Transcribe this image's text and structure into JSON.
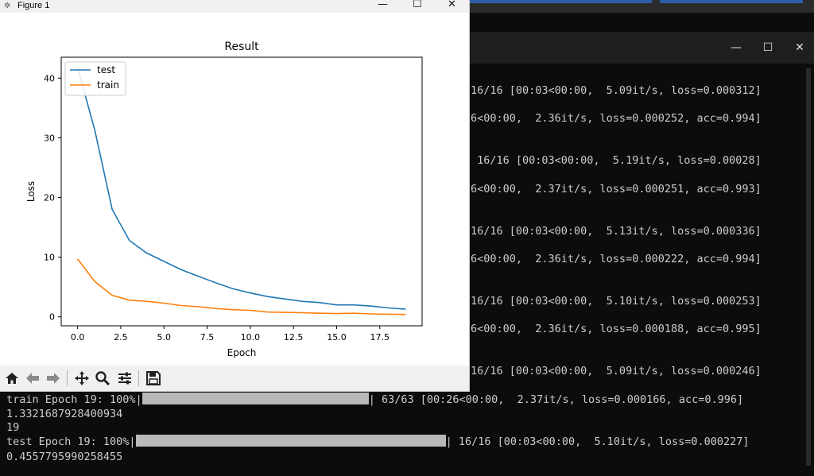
{
  "figure_window": {
    "title": "Figure 1",
    "controls": {
      "minimize": "—",
      "maximize": "☐",
      "close": "✕"
    }
  },
  "terminal_window": {
    "controls": {
      "minimize": "—",
      "maximize": "☐",
      "close": "✕"
    }
  },
  "toolbar": {
    "buttons": [
      "home-icon",
      "back-icon",
      "forward-icon",
      "pan-icon",
      "zoom-icon",
      "configure-subplots-icon",
      "save-icon"
    ]
  },
  "chart_data": {
    "type": "line",
    "title": "Result",
    "xlabel": "Epoch",
    "ylabel": "Loss",
    "xlim": [
      -0.95,
      19.95
    ],
    "ylim": [
      -1.5,
      43.5
    ],
    "xticks": [
      0.0,
      2.5,
      5.0,
      7.5,
      10.0,
      12.5,
      15.0,
      17.5
    ],
    "xtick_labels": [
      "0.0",
      "2.5",
      "5.0",
      "7.5",
      "10.0",
      "12.5",
      "15.0",
      "17.5"
    ],
    "yticks": [
      0,
      10,
      20,
      30,
      40
    ],
    "ytick_labels": [
      "0",
      "10",
      "20",
      "30",
      "40"
    ],
    "legend_position": "upper-left",
    "x": [
      0,
      1,
      2,
      3,
      4,
      5,
      6,
      7,
      8,
      9,
      10,
      11,
      12,
      13,
      14,
      15,
      16,
      17,
      18,
      19
    ],
    "series": [
      {
        "name": "test",
        "color": "#1f77b4",
        "values": [
          41.8,
          31.2,
          18.0,
          12.8,
          10.7,
          9.3,
          7.9,
          6.8,
          5.7,
          4.7,
          4.0,
          3.4,
          3.0,
          2.6,
          2.4,
          2.0,
          2.0,
          1.8,
          1.5,
          1.3
        ]
      },
      {
        "name": "train",
        "color": "#ff7f0e",
        "values": [
          9.7,
          5.9,
          3.6,
          2.8,
          2.6,
          2.3,
          1.9,
          1.7,
          1.4,
          1.2,
          1.1,
          0.8,
          0.75,
          0.7,
          0.6,
          0.55,
          0.6,
          0.5,
          0.45,
          0.4
        ]
      }
    ]
  },
  "terminal": {
    "lines": [
      {
        "text": "16/16 [00:03<00:00,  5.09it/s, loss=0.000312]"
      },
      {
        "text": "6<00:00,  2.36it/s, loss=0.000252, acc=0.994]"
      },
      {
        "text": " 16/16 [00:03<00:00,  5.19it/s, loss=0.00028]"
      },
      {
        "text": "6<00:00,  2.37it/s, loss=0.000251, acc=0.993]"
      },
      {
        "text": "16/16 [00:03<00:00,  5.13it/s, loss=0.000336]"
      },
      {
        "text": "6<00:00,  2.36it/s, loss=0.000222, acc=0.994]"
      },
      {
        "text": "16/16 [00:03<00:00,  5.10it/s, loss=0.000253]"
      },
      {
        "text": "6<00:00,  2.36it/s, loss=0.000188, acc=0.995]"
      },
      {
        "text": "16/16 [00:03<00:00,  5.09it/s, loss=0.000246]"
      }
    ],
    "train_epoch": {
      "prefix": "train Epoch 19: 100%|",
      "progress": 1.0,
      "suffix": "| 63/63 [00:26<00:00,  2.37it/s, loss=0.000166, acc=0.996]"
    },
    "value_1": "1.3321687928400934",
    "value_2": "19",
    "test_epoch": {
      "prefix": "test Epoch 19: 100%|",
      "progress": 1.0,
      "suffix": "| 16/16 [00:03<00:00,  5.10it/s, loss=0.000227]"
    },
    "value_3": "0.4557795990258455"
  }
}
